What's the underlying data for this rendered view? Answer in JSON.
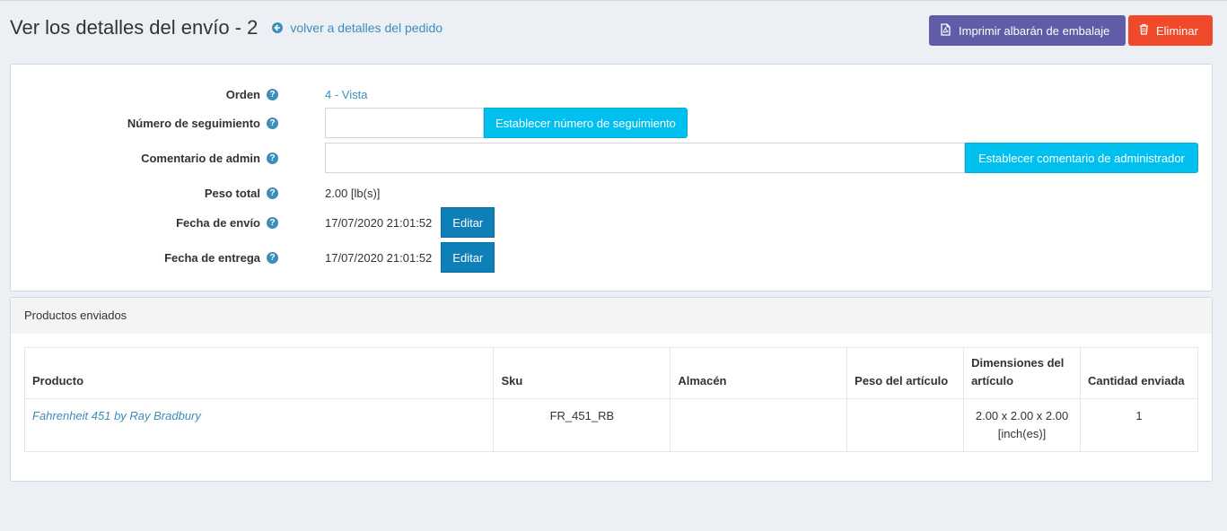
{
  "header": {
    "title": "Ver los detalles del envío - 2",
    "back_link": "volver a detalles del pedido",
    "print_button": "Imprimir albarán de embalaje",
    "delete_button": "Eliminar"
  },
  "details": {
    "order": {
      "label": "Orden",
      "value": "4 - Vista"
    },
    "tracking": {
      "label": "Número de seguimiento",
      "value": "",
      "button": "Establecer número de seguimiento"
    },
    "admin_comment": {
      "label": "Comentario de admin",
      "value": "",
      "button": "Establecer comentario de administrador"
    },
    "total_weight": {
      "label": "Peso total",
      "value": "2.00 [lb(s)]"
    },
    "ship_date": {
      "label": "Fecha de envío",
      "value": "17/07/2020 21:01:52",
      "button": "Editar"
    },
    "delivery_date": {
      "label": "Fecha de entrega",
      "value": "17/07/2020 21:01:52",
      "button": "Editar"
    }
  },
  "products": {
    "title": "Productos enviados",
    "columns": [
      "Producto",
      "Sku",
      "Almacén",
      "Peso del artículo",
      "Dimensiones del artículo",
      "Cantidad enviada"
    ],
    "rows": [
      {
        "product": "Fahrenheit 451 by Ray Bradbury",
        "sku": "FR_451_RB",
        "warehouse": "",
        "weight": "",
        "dimensions": "2.00 x 2.00 x 2.00 [inch(es)]",
        "quantity": "1"
      }
    ]
  },
  "colors": {
    "print_button": "#605ca8",
    "delete_button": "#f04a2a",
    "set_button": "#00c0ef",
    "edit_button": "#0f7fb8",
    "link": "#3c8dbc"
  },
  "icons": {
    "back": "arrow-circle-left-icon",
    "print": "file-pdf-icon",
    "delete": "trash-icon",
    "help": "question-circle-icon"
  }
}
